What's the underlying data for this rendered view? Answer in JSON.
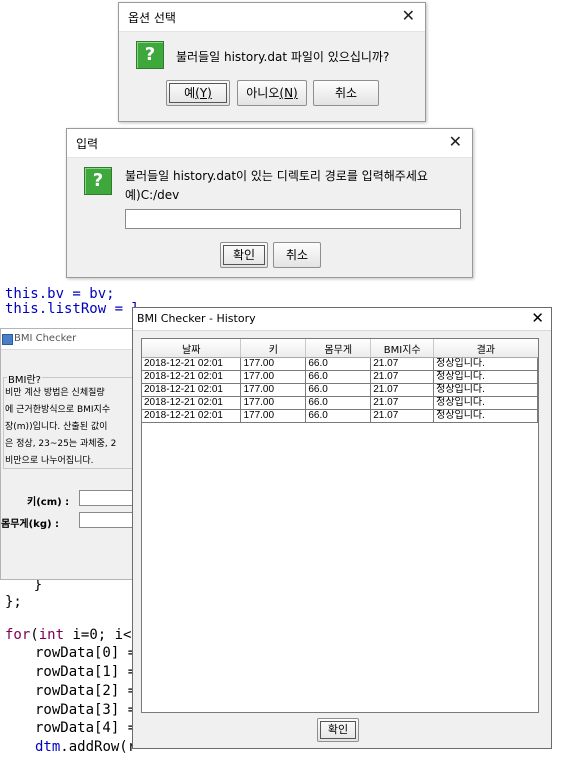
{
  "options_dialog": {
    "title": "옵션 선택",
    "message": "불러들일 history.dat 파일이 있으십니까?",
    "yes_label": "예",
    "yes_mnemonic": "(Y)",
    "no_label": "아니오",
    "no_mnemonic": "(N)",
    "cancel_label": "취소"
  },
  "input_dialog": {
    "title": "입력",
    "message_line1": "불러들일 history.dat이 있는 디렉토리 경로를 입력해주세요",
    "message_line2": "예)C:/dev",
    "input_value": "",
    "ok_label": "확인",
    "cancel_label": "취소"
  },
  "code_top": {
    "line1": "this.bv = bv;",
    "line2": "this.listRow = l"
  },
  "code_bottom": {
    "brace_line": "    }",
    "end_line": "};",
    "for_keyword": "for",
    "for_int": "int",
    "for_rest": " i=0; i<l",
    "rows": [
      "rowData[0] =",
      "rowData[1] =",
      "rowData[2] =",
      "rowData[3] =",
      "rowData[4] ="
    ],
    "dtm_var": "dtm",
    "dtm_rest": ".addRow(r"
  },
  "bmi_window": {
    "title": "BMI Checker",
    "group_title": "BMI란?",
    "desc_lines": [
      "비만 계산 방법은 신체질량",
      "에 근거한방식으로 BMI지수",
      "장(m))입니다. 산출된 값이",
      "은 정상, 23~25는 과체중, 2",
      "비만으로 나누어집니다."
    ],
    "height_label": "키(cm) :",
    "weight_label": "몸무게(kg) :"
  },
  "history_window": {
    "title": "BMI Checker - History",
    "columns": [
      "날짜",
      "키",
      "몸무게",
      "BMI지수",
      "결과"
    ],
    "rows": [
      [
        "2018-12-21 02:01",
        "177.00",
        "66.0",
        "21.07",
        "정상입니다."
      ],
      [
        "2018-12-21 02:01",
        "177.00",
        "66.0",
        "21.07",
        "정상입니다."
      ],
      [
        "2018-12-21 02:01",
        "177.00",
        "66.0",
        "21.07",
        "정상입니다."
      ],
      [
        "2018-12-21 02:01",
        "177.00",
        "66.0",
        "21.07",
        "정상입니다."
      ],
      [
        "2018-12-21 02:01",
        "177.00",
        "66.0",
        "21.07",
        "정상입니다."
      ]
    ],
    "ok_label": "확인"
  },
  "colors": {
    "question_icon": "#3fa83d",
    "keyword": "#7f0055",
    "variable": "#0000c0"
  },
  "icons": {
    "question": "?",
    "close": "✕"
  }
}
